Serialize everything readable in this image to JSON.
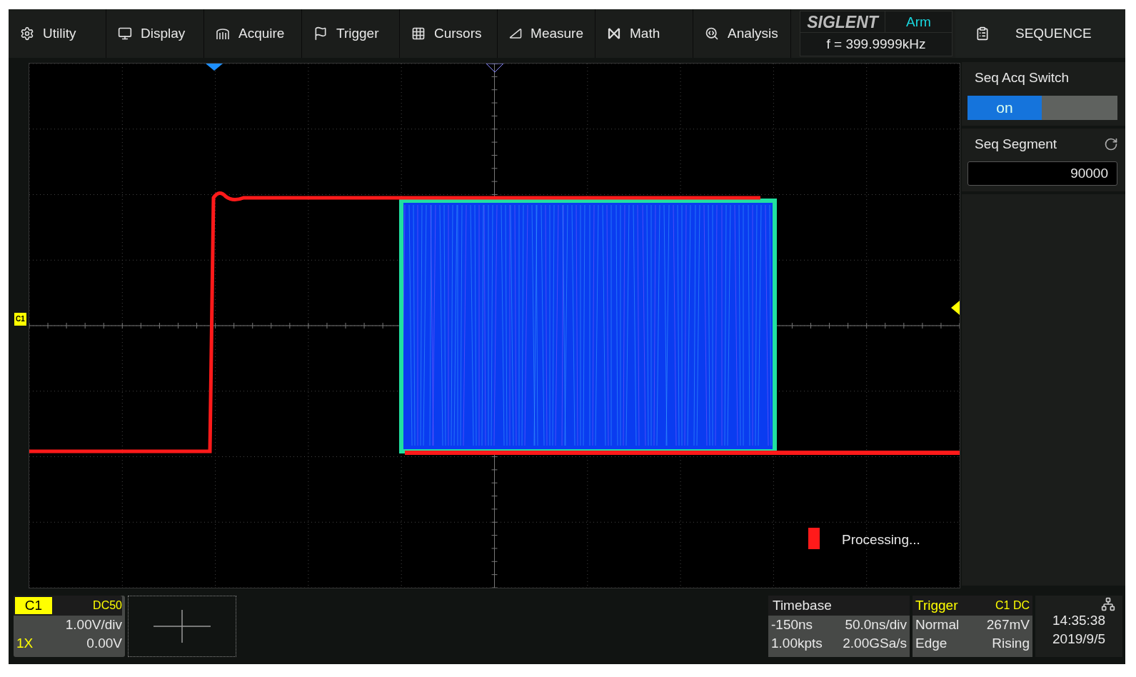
{
  "menu": [
    {
      "label": "Utility"
    },
    {
      "label": "Display"
    },
    {
      "label": "Acquire"
    },
    {
      "label": "Trigger"
    },
    {
      "label": "Cursors"
    },
    {
      "label": "Measure"
    },
    {
      "label": "Math"
    },
    {
      "label": "Analysis"
    }
  ],
  "status": {
    "brand": "SIGLENT",
    "state": "Arm",
    "frequency": "f = 399.9999kHz"
  },
  "side_panel": {
    "title": "SEQUENCE",
    "switch": {
      "label": "Seq Acq Switch",
      "value": "on",
      "on": true
    },
    "segment": {
      "label": "Seq Segment",
      "value": "90000"
    }
  },
  "plot": {
    "channel_marker": "C1",
    "processing": "Processing..."
  },
  "channel": {
    "name": "C1",
    "coupling": "DC50",
    "scale": "1.00V/div",
    "probe": "1X",
    "offset": "0.00V"
  },
  "timebase": {
    "title": "Timebase",
    "delay": "-150ns",
    "scale": "50.0ns/div",
    "memory": "1.00kpts",
    "rate": "2.00GSa/s"
  },
  "trigger": {
    "title": "Trigger",
    "source": "C1 DC",
    "mode": "Normal",
    "level": "267mV",
    "type": "Edge",
    "slope": "Rising"
  },
  "clock": {
    "time": "14:35:38",
    "date": "2019/9/5"
  }
}
